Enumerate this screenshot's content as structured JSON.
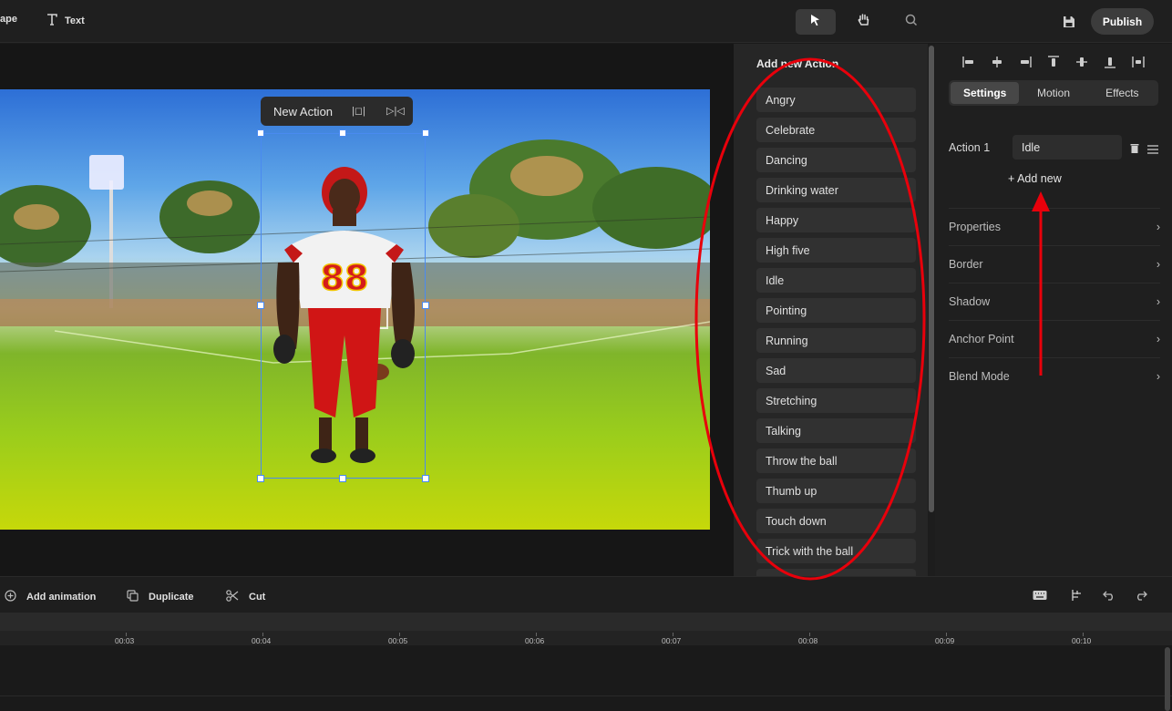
{
  "topbar": {
    "shape_label": "ape",
    "text_label": "Text",
    "publish_label": "Publish"
  },
  "canvas": {
    "action_pill_label": "New Action"
  },
  "actions_panel": {
    "title": "Add new Action",
    "items": [
      "Angry",
      "Celebrate",
      "Dancing",
      "Drinking water",
      "Happy",
      "High five",
      "Idle",
      "Pointing",
      "Running",
      "Sad",
      "Stretching",
      "Talking",
      "Throw the ball",
      "Thumb up",
      "Touch down",
      "Trick with the ball"
    ]
  },
  "right_panel": {
    "tabs": [
      "Settings",
      "Motion",
      "Effects"
    ],
    "active_tab": "Settings",
    "action_label": "Action 1",
    "action_value": "Idle",
    "add_new_label": "+ Add new",
    "sections": [
      "Properties",
      "Border",
      "Shadow",
      "Anchor Point",
      "Blend Mode"
    ]
  },
  "bottombar": {
    "add_animation_label": "Add animation",
    "duplicate_label": "Duplicate",
    "cut_label": "Cut"
  },
  "timeline": {
    "ticks": [
      "00:03",
      "00:04",
      "00:05",
      "00:06",
      "00:07",
      "00:08",
      "00:09",
      "00:10"
    ]
  },
  "colors": {
    "annotation": "#e8000b",
    "selection": "#4a8af0"
  }
}
